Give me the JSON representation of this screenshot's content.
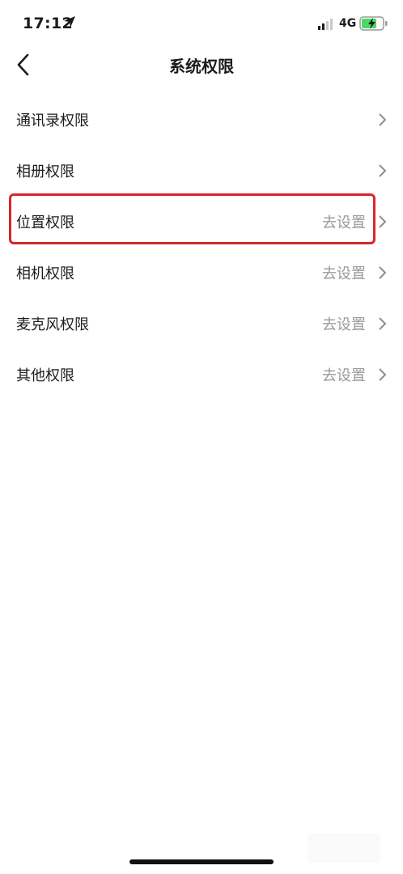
{
  "status_bar": {
    "time": "17:12",
    "network": "4G",
    "battery_color": "#4cd964"
  },
  "nav": {
    "title": "系统权限",
    "back_icon": "chevron-left-icon"
  },
  "permissions": [
    {
      "label": "通讯录权限",
      "action": ""
    },
    {
      "label": "相册权限",
      "action": ""
    },
    {
      "label": "位置权限",
      "action": "去设置",
      "highlighted": true
    },
    {
      "label": "相机权限",
      "action": "去设置"
    },
    {
      "label": "麦克风权限",
      "action": "去设置"
    },
    {
      "label": "其他权限",
      "action": "去设置"
    }
  ],
  "highlight_color": "#d9262c"
}
